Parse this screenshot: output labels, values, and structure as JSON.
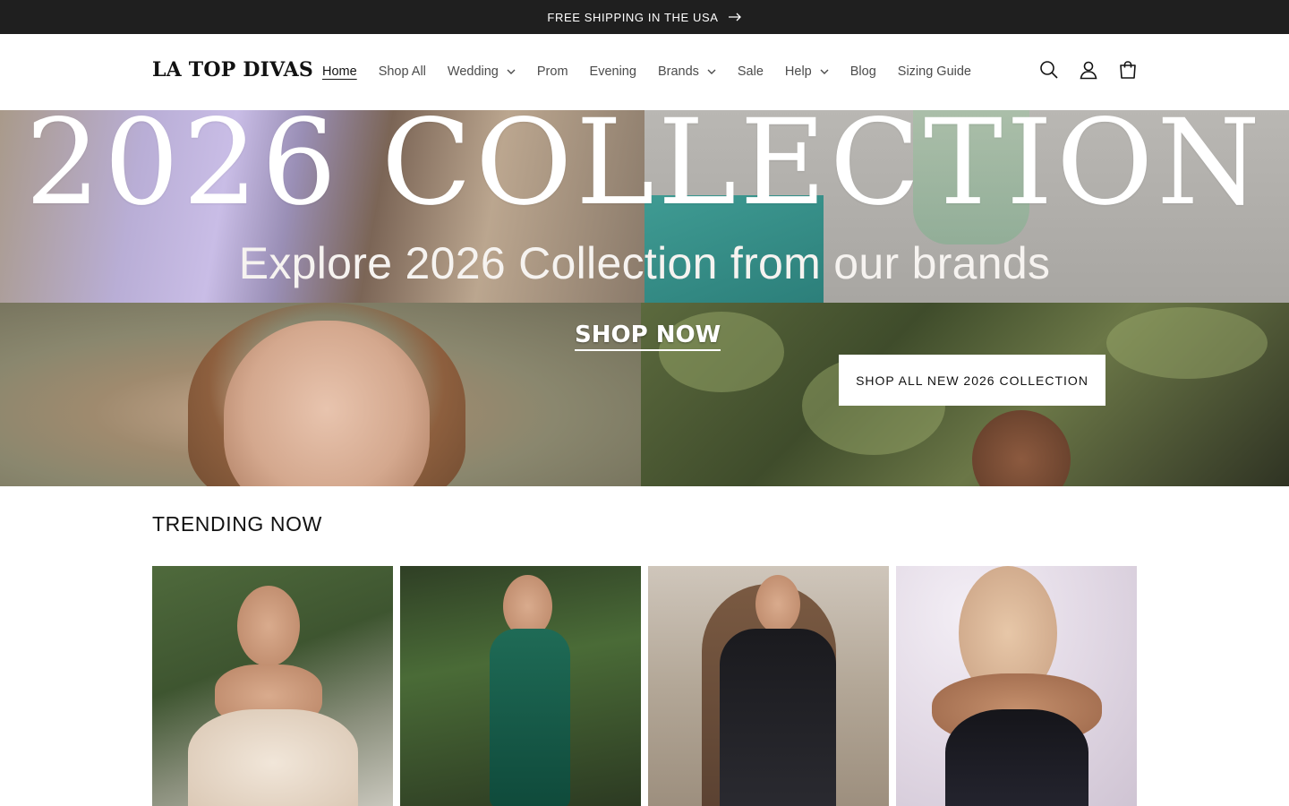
{
  "announcement": {
    "text": "FREE SHIPPING IN THE USA",
    "arrow_icon": "arrow-right-icon",
    "background": "#1f1f1f"
  },
  "header": {
    "logo": "LA TOP DIVAS",
    "nav": [
      {
        "label": "Home",
        "active": true,
        "dropdown": false
      },
      {
        "label": "Shop All",
        "active": false,
        "dropdown": false
      },
      {
        "label": "Wedding",
        "active": false,
        "dropdown": true
      },
      {
        "label": "Prom",
        "active": false,
        "dropdown": false
      },
      {
        "label": "Evening",
        "active": false,
        "dropdown": false
      },
      {
        "label": "Brands",
        "active": false,
        "dropdown": true
      },
      {
        "label": "Sale",
        "active": false,
        "dropdown": false
      },
      {
        "label": "Help",
        "active": false,
        "dropdown": true
      },
      {
        "label": "Blog",
        "active": false,
        "dropdown": false
      },
      {
        "label": "Sizing Guide",
        "active": false,
        "dropdown": false
      }
    ],
    "icons": [
      "search-icon",
      "account-icon",
      "cart-icon"
    ]
  },
  "hero": {
    "title": "2026 COLLECTION",
    "subtitle": "Explore 2026 Collection from our brands",
    "shop_now": "SHOP NOW",
    "button_label": "SHOP ALL NEW 2026 COLLECTION"
  },
  "trending": {
    "title": "TRENDING NOW",
    "cards_count": 4
  }
}
